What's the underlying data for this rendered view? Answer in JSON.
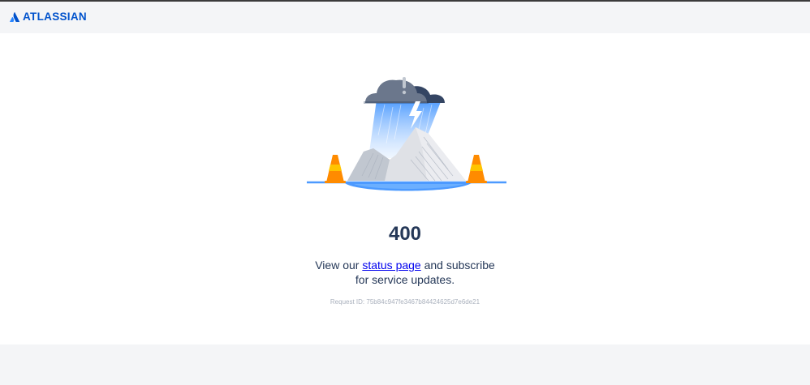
{
  "header": {
    "logo_text": "ATLASSIAN",
    "logo_icon": "atlassian-triangle-icon"
  },
  "error": {
    "code": "400",
    "message_prefix": "View our ",
    "status_link_text": "status page",
    "message_suffix": " and subscribe for service updates.",
    "request_id": "Request ID: 75b84c947fe3467b84424625d7e6de21",
    "illustration": "storm-cloud-mountains-traffic-cones"
  },
  "colors": {
    "brand": "#0052cc",
    "heading": "#253858",
    "link": "#0000ee",
    "page_bg": "#f4f5f7"
  }
}
